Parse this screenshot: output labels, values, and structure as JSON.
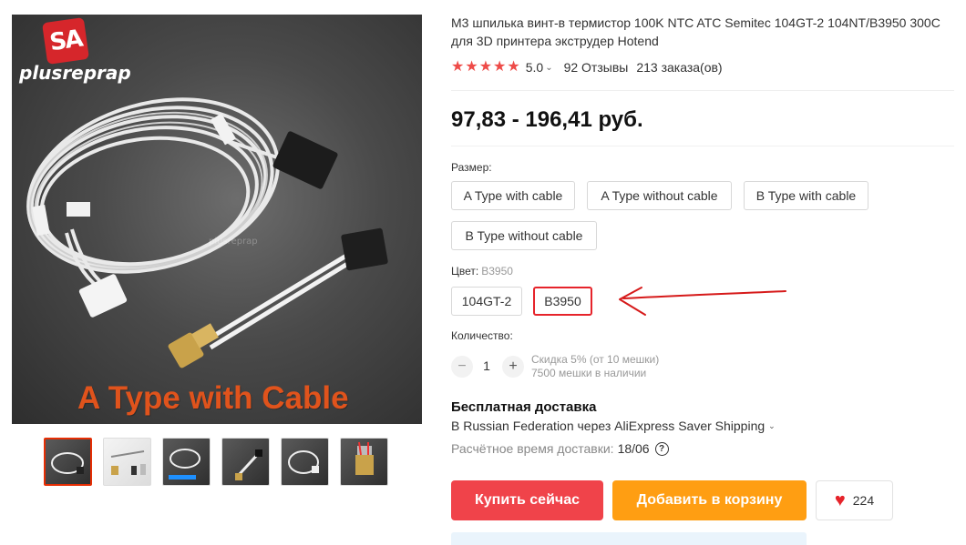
{
  "gallery": {
    "logo_mark": "SA",
    "logo_text": "plusreprap",
    "watermark": "plusreprap",
    "caption": "A Type with Cable",
    "thumbnails": [
      {
        "icon": "cable-coil-thumb",
        "active": true
      },
      {
        "icon": "probe-parts-thumb",
        "active": false
      },
      {
        "icon": "cable-coil-blue-label-thumb",
        "active": false
      },
      {
        "icon": "probe-connector-thumb",
        "active": false
      },
      {
        "icon": "cable-coil-thumb-2",
        "active": false
      },
      {
        "icon": "hotend-block-thumb",
        "active": false
      }
    ]
  },
  "product": {
    "title": "M3 шпилька винт-в термистор 100K NTC ATC Semitec 104GT-2 104NT/B3950 300C для 3D принтера экструдер Hotend",
    "rating": "5.0",
    "reviews": "92 Отзывы",
    "orders": "213 заказа(ов)",
    "price": "97,83 - 196,41 руб.",
    "colors": {
      "star": "#ee4b48",
      "buy": "#f0434a",
      "cart": "#ff9e12",
      "selected_border": "#e6242b"
    }
  },
  "options": {
    "size_label": "Размер:",
    "sizes": [
      "A Type with cable",
      "A Type without cable",
      "B Type with cable",
      "B Type without cable"
    ],
    "color_label": "Цвет:",
    "color_selected": "B3950",
    "colors": [
      "104GT-2",
      "B3950"
    ],
    "qty_label": "Количество:",
    "qty_minus": "−",
    "qty_value": "1",
    "qty_plus": "+",
    "discount_note": "Скидка 5% (от 10 мешки)",
    "stock_note": "7500 мешки в наличии"
  },
  "shipping": {
    "title": "Бесплатная доставка",
    "route": "В Russian Federation через AliExpress Saver Shipping",
    "eta_label": "Расчётное время доставки:",
    "eta_date": "18/06",
    "help": "?"
  },
  "actions": {
    "buy_now": "Купить сейчас",
    "add_to_cart": "Добавить в корзину",
    "wishlist_count": "224"
  }
}
